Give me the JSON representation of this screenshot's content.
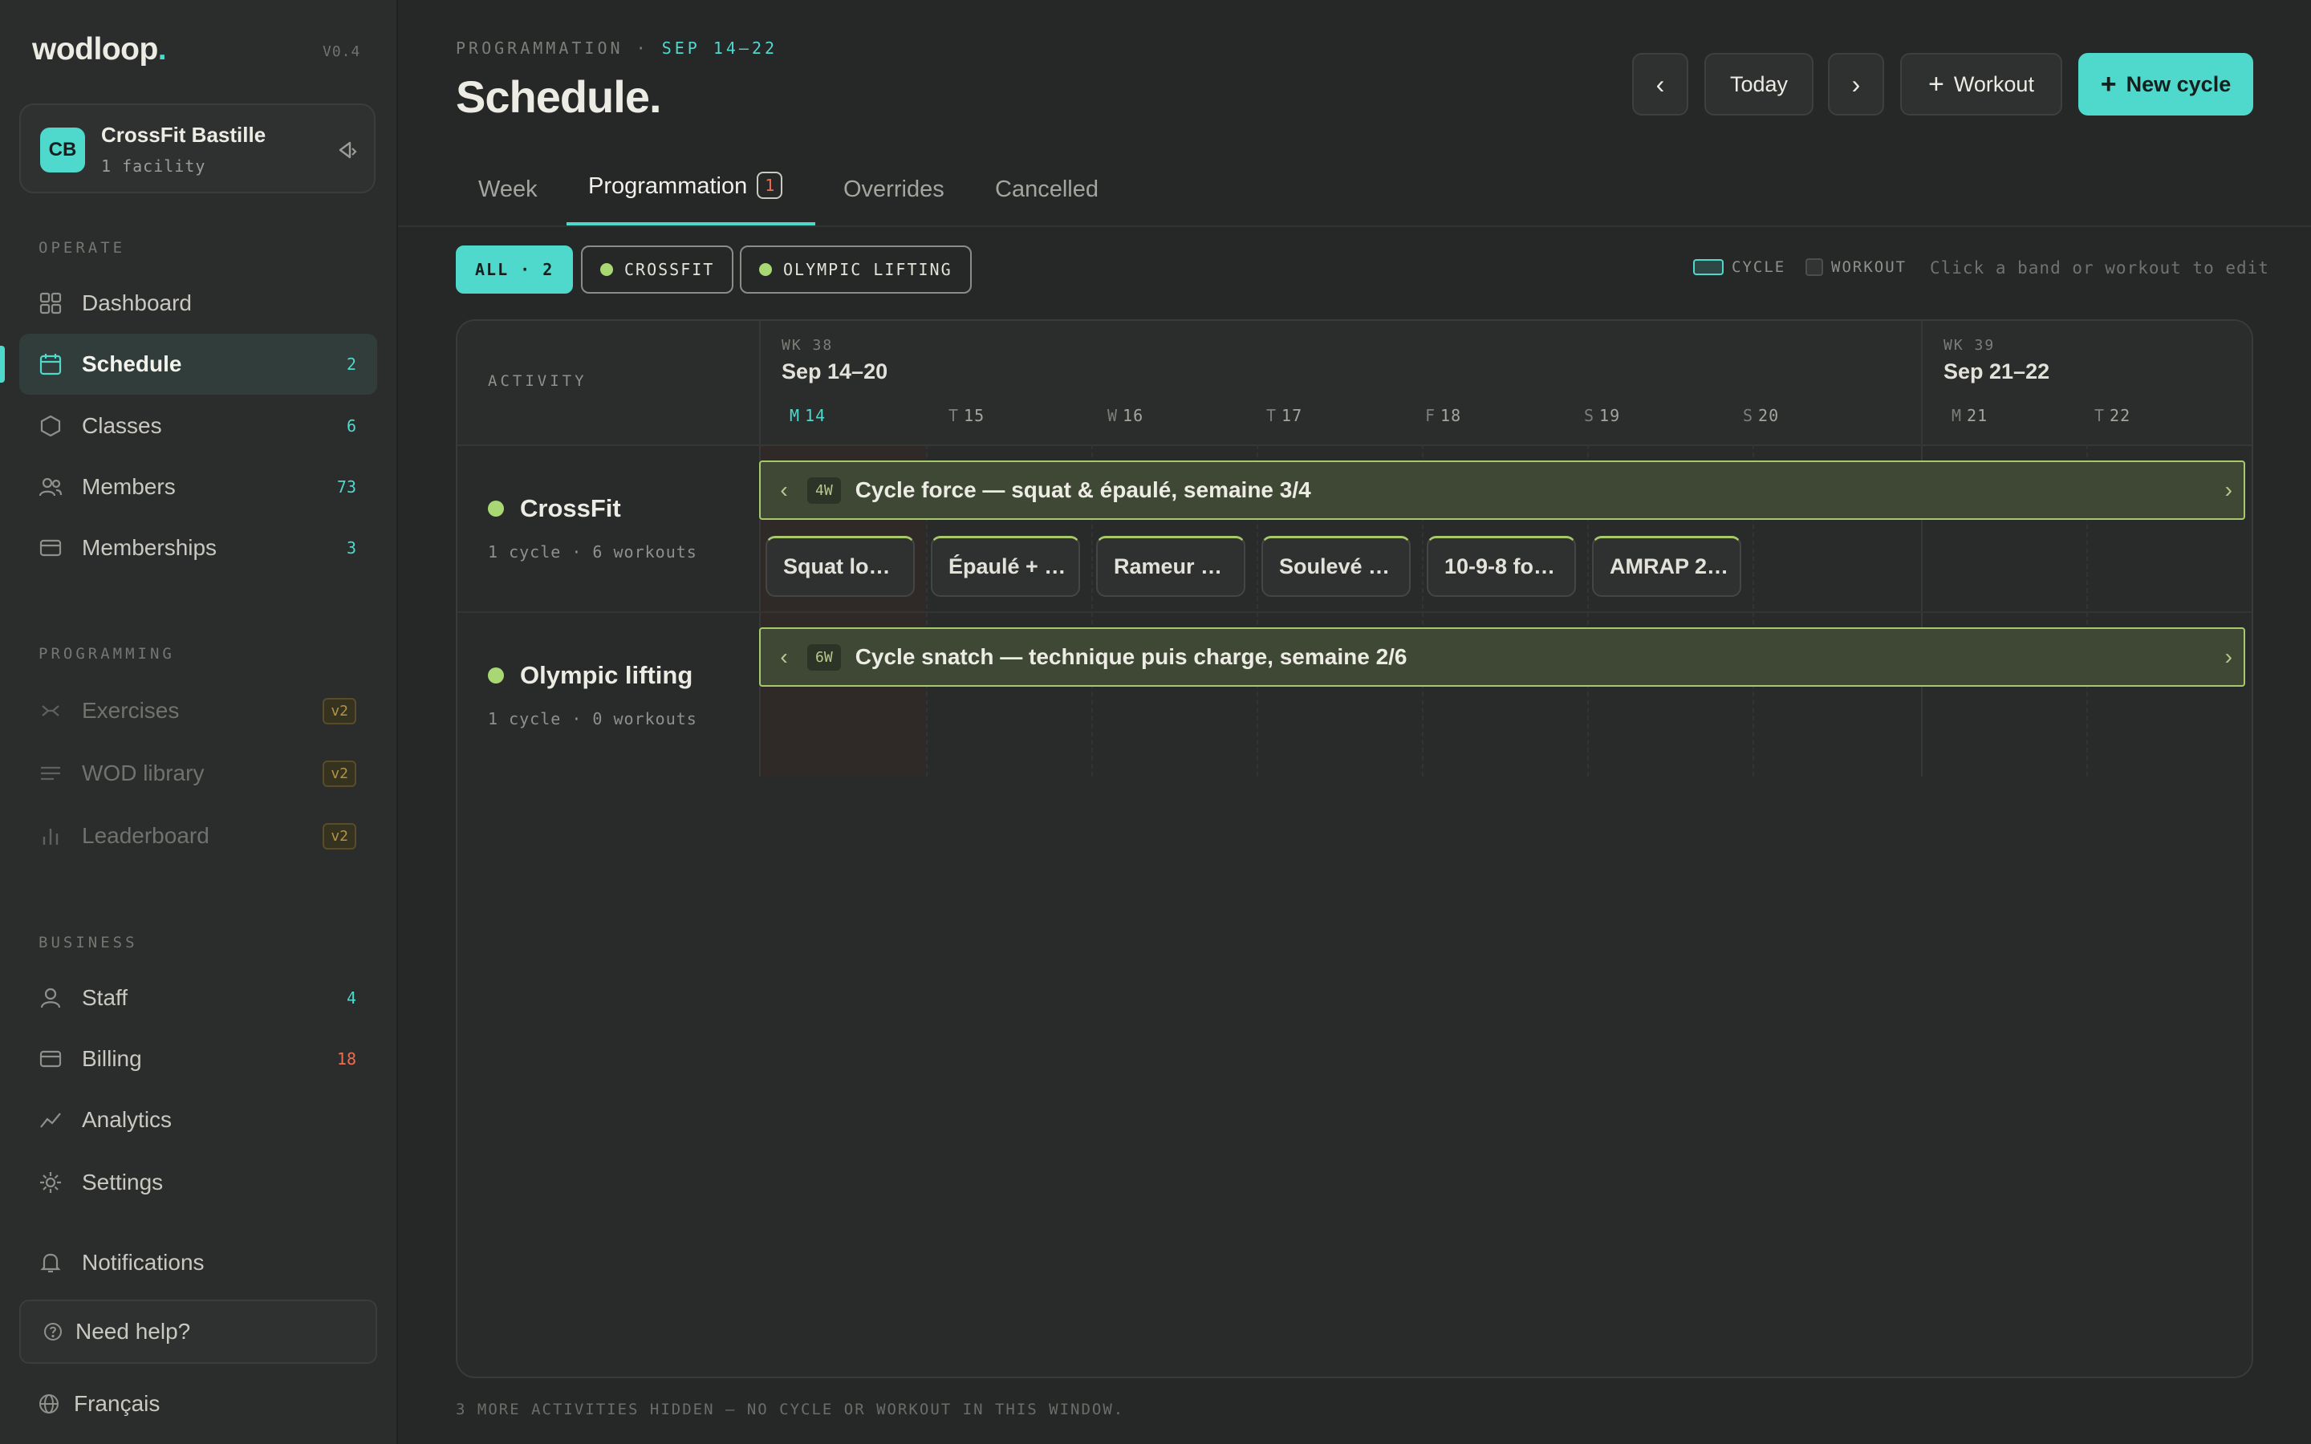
{
  "sidebar": {
    "logo": "wodloop",
    "logo_dot": ".",
    "version": "V0.4",
    "facility": {
      "initials": "CB",
      "name": "CrossFit Bastille",
      "sub": "1 facility"
    },
    "sections": {
      "operate": "OPERATE",
      "programming": "PROGRAMMING",
      "business": "BUSINESS"
    },
    "items": [
      {
        "label": "Dashboard",
        "icon": "grid-icon"
      },
      {
        "label": "Schedule",
        "count": "2",
        "icon": "calendar-icon"
      },
      {
        "label": "Classes",
        "count": "6",
        "icon": "hexagon-icon"
      },
      {
        "label": "Members",
        "count": "73",
        "icon": "users-icon"
      },
      {
        "label": "Memberships",
        "count": "3",
        "icon": "card-icon"
      },
      {
        "label": "Exercises",
        "soon": "v2",
        "icon": "dumbbell-icon"
      },
      {
        "label": "WOD library",
        "soon": "v2",
        "icon": "list-icon"
      },
      {
        "label": "Leaderboard",
        "soon": "v2",
        "icon": "bars-icon"
      },
      {
        "label": "Staff",
        "count": "4",
        "icon": "user-icon"
      },
      {
        "label": "Billing",
        "count": "18",
        "icon": "card-icon"
      },
      {
        "label": "Analytics",
        "icon": "trend-icon"
      },
      {
        "label": "Settings",
        "icon": "gear-icon"
      },
      {
        "label": "Notifications",
        "icon": "bell-icon"
      }
    ],
    "help": "Need help?",
    "language": "Français"
  },
  "header": {
    "crumb": "PROGRAMMATION",
    "crumb_sep": "·",
    "crumb_range": "SEP 14–22",
    "title": "Schedule.",
    "prev": "‹",
    "today": "Today",
    "next": "›",
    "workout": "Workout",
    "new_cycle": "New cycle"
  },
  "tabs": [
    {
      "label": "Week"
    },
    {
      "label": "Programmation",
      "badge": "1"
    },
    {
      "label": "Overrides"
    },
    {
      "label": "Cancelled"
    }
  ],
  "filters": {
    "all": "ALL · 2",
    "crossfit": "CROSSFIT",
    "olympic": "OLYMPIC LIFTING",
    "legend_cycle": "CYCLE",
    "legend_workout": "WORKOUT",
    "hint": "Click a band or workout to edit"
  },
  "grid": {
    "activity_header": "ACTIVITY",
    "weeks": [
      {
        "label": "WK 38",
        "range": "Sep 14–20"
      },
      {
        "label": "WK 39",
        "range": "Sep 21–22"
      }
    ],
    "days": [
      {
        "d": "M",
        "n": "14",
        "today": true
      },
      {
        "d": "T",
        "n": "15"
      },
      {
        "d": "W",
        "n": "16"
      },
      {
        "d": "T",
        "n": "17"
      },
      {
        "d": "F",
        "n": "18"
      },
      {
        "d": "S",
        "n": "19"
      },
      {
        "d": "S",
        "n": "20"
      },
      {
        "d": "M",
        "n": "21"
      },
      {
        "d": "T",
        "n": "22"
      }
    ],
    "rows": [
      {
        "name": "CrossFit",
        "sub": "1 cycle · 6 workouts",
        "cycle": {
          "length": "4W",
          "title": "Cycle force — squat & épaulé, semaine 3/4"
        },
        "workouts": [
          "Squat lo…",
          "Épaulé + …",
          "Rameur …",
          "Soulevé …",
          "10-9-8 fo…",
          "AMRAP 2…"
        ]
      },
      {
        "name": "Olympic lifting",
        "sub": "1 cycle · 0 workouts",
        "cycle": {
          "length": "6W",
          "title": "Cycle snatch — technique puis charge, semaine 2/6"
        },
        "workouts": []
      }
    ],
    "arrow_left": "‹",
    "arrow_right": "›"
  },
  "footnote": "3 MORE ACTIVITIES HIDDEN — NO CYCLE OR WORKOUT IN THIS WINDOW.",
  "colors": {
    "accent": "#4fd8cc",
    "activity": "#a8d873",
    "alert": "#ef6d4e",
    "warning": "#b39447"
  }
}
